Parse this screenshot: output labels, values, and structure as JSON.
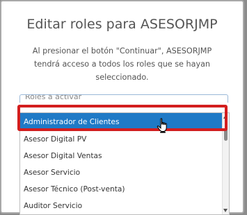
{
  "dialog": {
    "title": "Editar roles para ASESORJMP",
    "description": "Al presionar el botón \"Continuar\", ASESORJMP tendrá acceso a todos los roles que se hayan seleccionado."
  },
  "roles_field": {
    "label": "Roles a activar"
  },
  "roles_list": {
    "selected": "Administrador de Clientes",
    "options": [
      "Administrador de Clientes",
      "Asesor Digital PV",
      "Asesor Digital Ventas",
      "Asesor Servicio",
      "Asesor Técnico (Post-venta)",
      "Auditor Servicio"
    ]
  },
  "colors": {
    "selected_background": "#1f7ac6",
    "highlight_border": "#d31e1e"
  },
  "icons": {
    "pointer": "hand-pointer-icon"
  }
}
